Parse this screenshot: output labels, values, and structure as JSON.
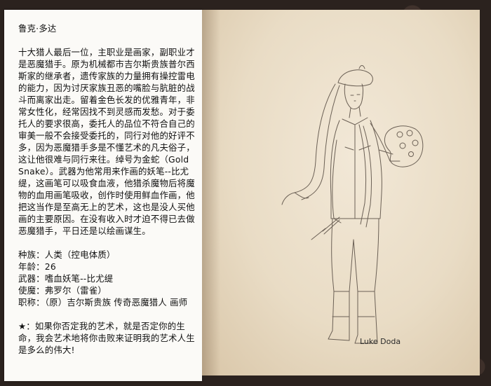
{
  "profile": {
    "name": "鲁克·多达",
    "bio": "十大猎人最后一位，主职业是画家，副职业才是恶魔猎手。原为机械都市吉尔斯贵族普尔西斯家的继承者，遗传家族的力量拥有操控雷电的能力，因为讨厌家族丑恶的嘴脸与肮脏的战斗而离家出走。留着金色长发的优雅青年，非常女性化，经常因找不到灵感而发愁。对于委托人的要求很高，委托人的品位不符合自己的审美一般不会接受委托的，同行对他的好评不多，因为恶魔猎手多是不懂艺术的凡夫俗子，这让他很难与同行来往。绰号为金蛇（Gold Snake）。武器为他常用来作画的妖笔--比尤缇，这画笔可以吸食血液，他猎杀魔物后将魔物的血用画笔吸收，创作时使用鲜血作画，他把这当作是至高无上的艺术，这也是没人买他画的主要原因。在没有收入时才迫不得已去做恶魔猎手，平日还是以绘画谋生。",
    "stats": [
      "种族：人类（控电体质）",
      "年龄：26",
      "武器：嗜血妖笔--比尤缇",
      "使魔：弗罗尔（雷雀）",
      "职称：（原）吉尔斯贵族 传奇恶魔猎人 画师"
    ],
    "quote": "★：如果你否定我的艺术，就是否定你的生命，我会艺术地将你击败来证明我的艺术人生是多么的伟大!"
  },
  "artwork": {
    "signature": "Luke Doda"
  }
}
